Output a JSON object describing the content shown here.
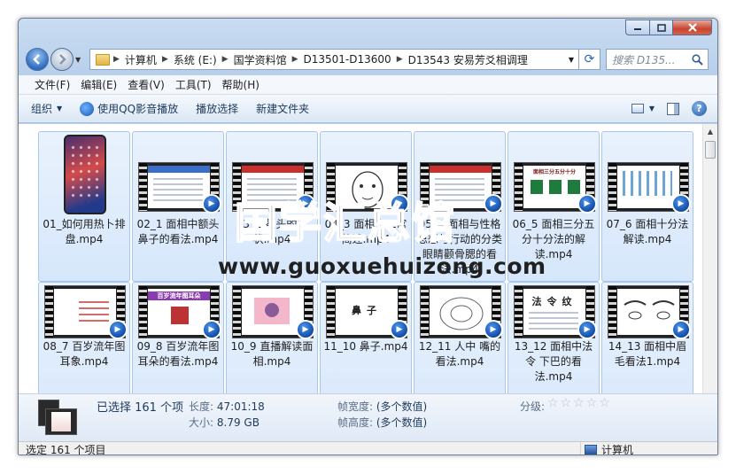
{
  "window": {
    "caption_buttons": [
      "minimize-icon",
      "maximize-icon",
      "close-icon"
    ]
  },
  "address_bar": {
    "crumbs": [
      "计算机",
      "系统 (E:)",
      "国学资料馆",
      "D13501-D13600",
      "D13543 安易芳爻相调理"
    ],
    "search_placeholder": "搜索 D135...",
    "separator": "▶"
  },
  "menubar": [
    "文件(F)",
    "编辑(E)",
    "查看(V)",
    "工具(T)",
    "帮助(H)"
  ],
  "toolbar": {
    "organize": "组织",
    "play_qq": "使用QQ影音播放",
    "play_selection": "播放选择",
    "new_folder": "新建文件夹"
  },
  "files_row1": [
    "01_如何用热卜排盘.mp4",
    "02_1 面相中额头鼻子的看法.mp4",
    "03_2 额头的形状.mp4",
    "04_3 面相十二宫简述.mp4",
    "05_4 面相与性格思想与行动的分类 眼睛颧骨腮的看法.mp4",
    "06_5 面相三分五分十分法的解读.mp4",
    "07_6 面相十分法解读.mp4"
  ],
  "files_row2": [
    "08_7 百岁流年图 耳象.mp4",
    "09_8 百岁流年图耳朵的看法.mp4",
    "10_9 直播解读面相.mp4",
    "11_10 鼻子.mp4",
    "12_11 人中 嘴的看法.mp4",
    "13_12 面相中法令 下巴的看法.mp4",
    "14_13 面相中眉毛看法1.mp4"
  ],
  "thumb_text": {
    "nose": "鼻子",
    "fold": "法令纹",
    "sanfen": "面相三分五分十分",
    "ear_banner": "百岁流年图耳朵"
  },
  "watermark": {
    "cn": "国学汇总馆",
    "url": "www.guoxuehuizong.com"
  },
  "details": {
    "selected": "已选择 161 个项",
    "length_label": "长度:",
    "length": "47:01:18",
    "size_label": "大小:",
    "size": "8.79 GB",
    "frame_width_label": "帧宽度:",
    "frame_width": "(多个数值)",
    "frame_height_label": "帧高度:",
    "frame_height": "(多个数值)",
    "rating_label": "分级:",
    "rating": "☆☆☆☆☆"
  },
  "statusbar": {
    "left": "选定 161 个项目",
    "right": "计算机"
  }
}
